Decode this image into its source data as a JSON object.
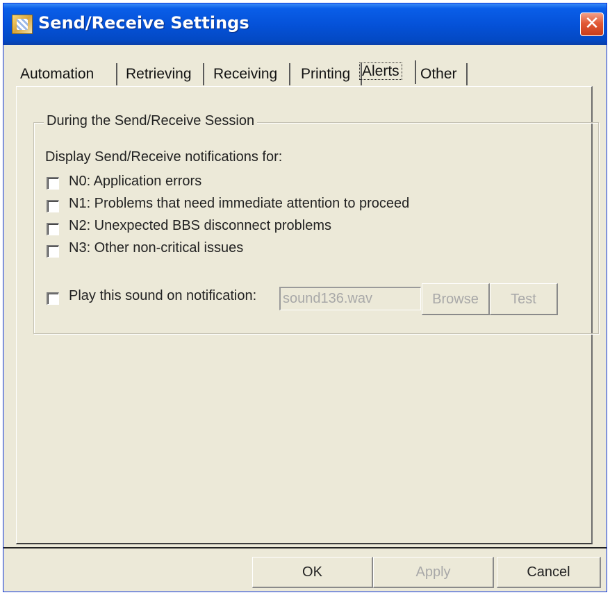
{
  "window": {
    "title": "Send/Receive Settings",
    "close_glyph": "✕"
  },
  "tabs": [
    {
      "label": "Automation"
    },
    {
      "label": "Retrieving"
    },
    {
      "label": "Receiving"
    },
    {
      "label": "Printing"
    },
    {
      "label": "Alerts",
      "selected": true
    },
    {
      "label": "Other"
    }
  ],
  "group": {
    "label": "During the Send/Receive Session",
    "notifications_heading": "Display Send/Receive notifications for:",
    "options": [
      {
        "label": "N0: Application errors",
        "checked": false
      },
      {
        "label": "N1: Problems that need immediate attention to proceed",
        "checked": false
      },
      {
        "label": "N2: Unexpected BBS disconnect problems",
        "checked": false
      },
      {
        "label": "N3: Other non-critical issues",
        "checked": false
      }
    ],
    "sound": {
      "label": "Play this sound on notification:",
      "checked": false,
      "file_value": "sound136.wav",
      "browse_label": "Browse",
      "test_label": "Test"
    }
  },
  "footer": {
    "ok_label": "OK",
    "apply_label": "Apply",
    "cancel_label": "Cancel"
  },
  "icons": {
    "window_icon": "send-receive-app-icon",
    "close": "close-icon"
  },
  "colors": {
    "titlebar": "#0552d9",
    "dialog_bg": "#ece9d8",
    "close_button": "#e25a36",
    "disabled_text": "#a8a8a8"
  }
}
